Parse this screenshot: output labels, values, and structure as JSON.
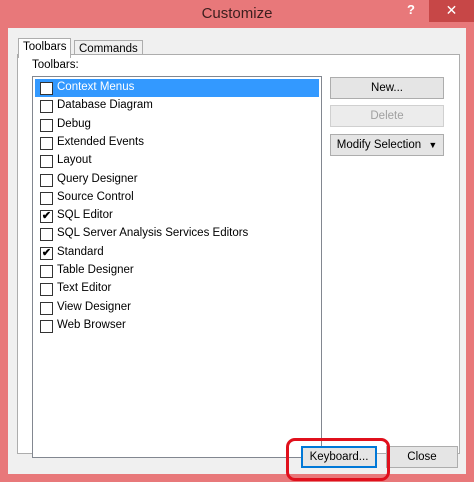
{
  "window": {
    "title": "Customize",
    "help_glyph": "?",
    "close_glyph": "✕"
  },
  "tabs": [
    {
      "label": "Toolbars",
      "active": true
    },
    {
      "label": "Commands",
      "active": false
    }
  ],
  "toolbars_label": "Toolbars:",
  "toolbars": [
    {
      "label": "Context Menus",
      "checked": false,
      "selected": true
    },
    {
      "label": "Database Diagram",
      "checked": false
    },
    {
      "label": "Debug",
      "checked": false
    },
    {
      "label": "Extended Events",
      "checked": false
    },
    {
      "label": "Layout",
      "checked": false
    },
    {
      "label": "Query Designer",
      "checked": false
    },
    {
      "label": "Source Control",
      "checked": false
    },
    {
      "label": "SQL Editor",
      "checked": true
    },
    {
      "label": "SQL Server Analysis Services Editors",
      "checked": false
    },
    {
      "label": "Standard",
      "checked": true
    },
    {
      "label": "Table Designer",
      "checked": false
    },
    {
      "label": "Text Editor",
      "checked": false
    },
    {
      "label": "View Designer",
      "checked": false
    },
    {
      "label": "Web Browser",
      "checked": false
    }
  ],
  "check_glyph": "✔",
  "buttons": {
    "new": "New...",
    "delete": "Delete",
    "modify_selection": "Modify Selection",
    "modify_arrow": "▼",
    "keyboard": "Keyboard...",
    "close": "Close"
  },
  "colors": {
    "window_frame": "#e8787a",
    "selection": "#3399ff",
    "highlight_ring": "#e0101c"
  }
}
